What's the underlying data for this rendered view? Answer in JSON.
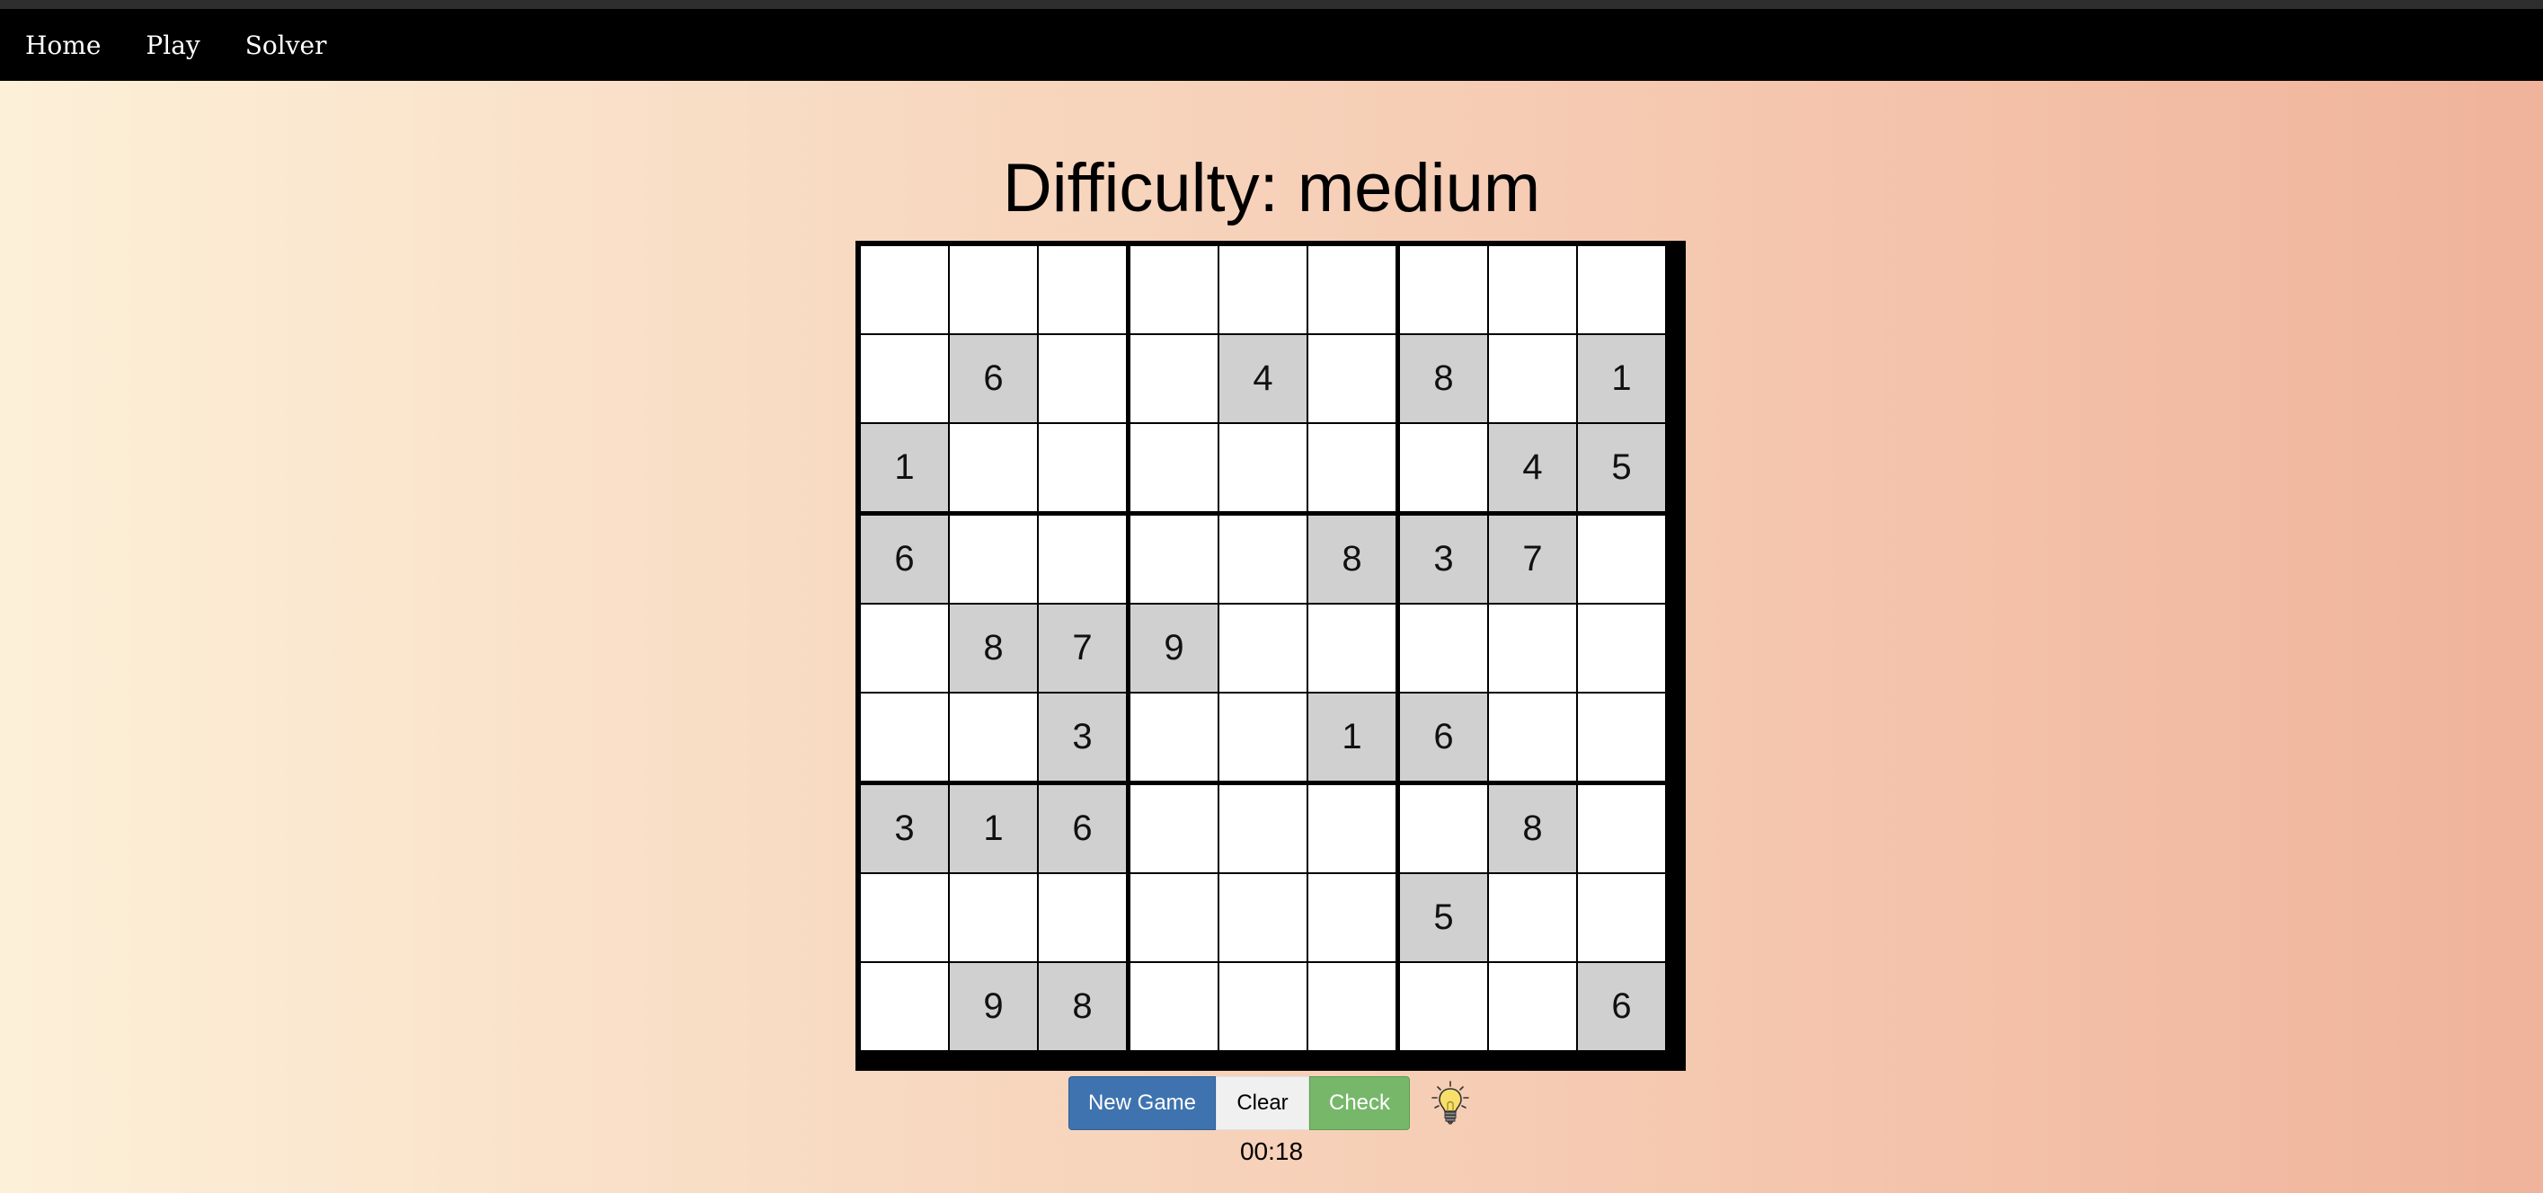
{
  "nav": {
    "items": [
      {
        "label": "Home"
      },
      {
        "label": "Play"
      },
      {
        "label": "Solver"
      }
    ]
  },
  "game": {
    "difficulty_label": "Difficulty: medium",
    "grid": [
      [
        "",
        "",
        "",
        "",
        "",
        "",
        "",
        "",
        ""
      ],
      [
        "",
        "6",
        "",
        "",
        "4",
        "",
        "8",
        "",
        "1"
      ],
      [
        "1",
        "",
        "",
        "",
        "",
        "",
        "",
        "4",
        "5"
      ],
      [
        "6",
        "",
        "",
        "",
        "",
        "8",
        "3",
        "7",
        ""
      ],
      [
        "",
        "8",
        "7",
        "9",
        "",
        "",
        "",
        "",
        ""
      ],
      [
        "",
        "",
        "3",
        "",
        "",
        "1",
        "6",
        "",
        ""
      ],
      [
        "3",
        "1",
        "6",
        "",
        "",
        "",
        "",
        "8",
        ""
      ],
      [
        "",
        "",
        "",
        "",
        "",
        "",
        "5",
        "",
        ""
      ],
      [
        "",
        "9",
        "8",
        "",
        "",
        "",
        "",
        "",
        "6"
      ]
    ],
    "timer": "00:18"
  },
  "controls": {
    "new_game": "New Game",
    "clear": "Clear",
    "check": "Check",
    "hint_icon": "lightbulb-icon"
  },
  "colors": {
    "given_cell": "#d0d0d0",
    "empty_cell": "#ffffff",
    "new_game_button": "#3f73b0",
    "check_button": "#77b76a"
  }
}
